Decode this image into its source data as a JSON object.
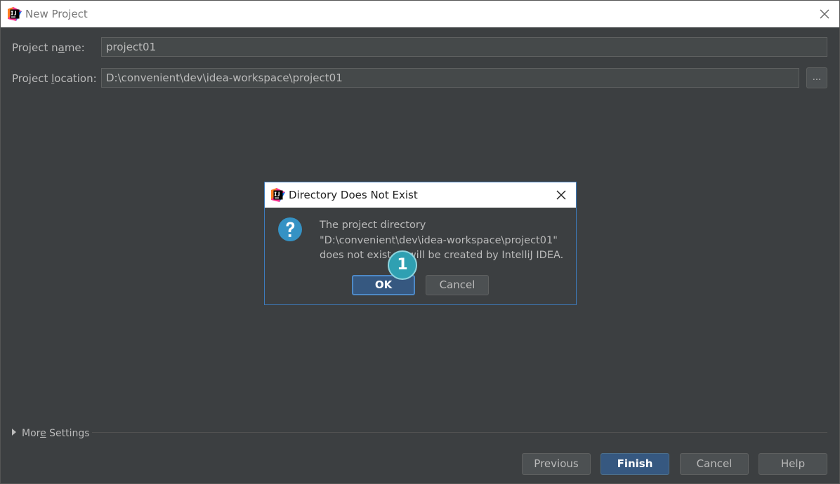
{
  "window": {
    "title": "New Project"
  },
  "form": {
    "project_name_label_pre": "Project n",
    "project_name_label_mn": "a",
    "project_name_label_post": "me:",
    "project_name_value": "project01",
    "project_location_label_pre": "Project ",
    "project_location_label_mn": "l",
    "project_location_label_post": "ocation:",
    "project_location_value": "D:\\convenient\\dev\\idea-workspace\\project01",
    "browse_label": "..."
  },
  "more_settings": {
    "label_pre": "Mor",
    "label_mn": "e",
    "label_post": " Settings"
  },
  "footer": {
    "previous_label": "Previous",
    "finish_label": "Finish",
    "cancel_label": "Cancel",
    "help_label": "Help"
  },
  "dialog": {
    "title": "Directory Does Not Exist",
    "message_line1": "The project directory",
    "message_line2": "\"D:\\convenient\\dev\\idea-workspace\\project01\"",
    "message_line3": "does not exist. It will be created by IntelliJ IDEA.",
    "ok_label": "OK",
    "cancel_label": "Cancel",
    "icon": "question-icon"
  },
  "annotation": {
    "step_number": "1"
  },
  "colors": {
    "background": "#3c3f41",
    "primary_button": "#365880",
    "dialog_border": "#3d7bbd",
    "question_icon": "#3592c4",
    "step_badge": "#2fa0b2"
  }
}
